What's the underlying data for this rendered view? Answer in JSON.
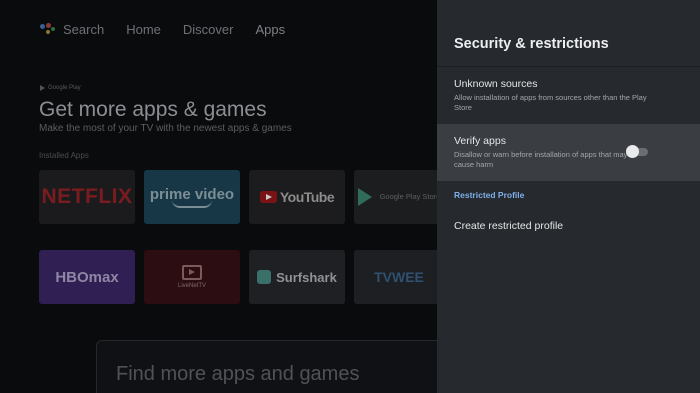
{
  "nav": {
    "search_label": "Search",
    "items": [
      "Home",
      "Discover",
      "Apps"
    ],
    "active": "Apps"
  },
  "promo": {
    "store_label": "Google Play",
    "headline": "Get more apps & games",
    "subline": "Make the most of your TV with the newest apps & games",
    "installed_label": "Installed Apps"
  },
  "apps_row1": [
    "NETFLIX",
    "prime video",
    "YouTube",
    "Google Play Store"
  ],
  "apps_row2": [
    "HBOmax",
    "LiveNetTV",
    "Surfshark",
    "TVWEE"
  ],
  "find_more": "Find more apps and games",
  "settings": {
    "title": "Security & restrictions",
    "unknown_sources": {
      "title": "Unknown sources",
      "desc": "Allow installation of apps from sources other than the Play Store"
    },
    "verify_apps": {
      "title": "Verify apps",
      "desc": "Disallow or warn before installation of apps that may cause harm",
      "enabled": false
    },
    "restricted_profile_label": "Restricted Profile",
    "create_restricted_profile": "Create restricted profile"
  },
  "colors": {
    "panel_bg": "#26292d",
    "focused_row": "#3a3d42",
    "accent_link": "#7fb0ea"
  }
}
